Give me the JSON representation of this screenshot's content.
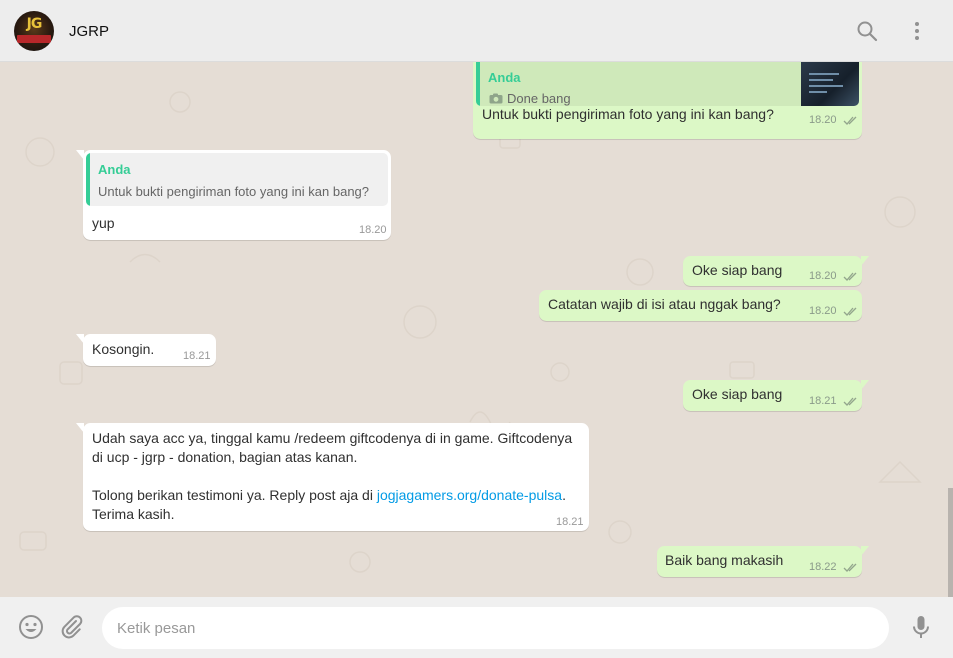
{
  "header": {
    "contact_name": "JGRP",
    "avatar_logo": "JG",
    "search_icon": "search-icon",
    "menu_icon": "more-vertical-icon"
  },
  "messages": [
    {
      "direction": "out",
      "quote": {
        "author": "Anda",
        "text": "Done bang",
        "icon": "camera-icon",
        "has_thumbnail": true
      },
      "text": "Untuk bukti pengiriman foto yang ini kan bang?",
      "time": "18.20",
      "status": "read"
    },
    {
      "direction": "in",
      "quote": {
        "author": "Anda",
        "text": "Untuk bukti pengiriman foto yang ini kan bang?"
      },
      "text": "yup",
      "time": "18.20"
    },
    {
      "direction": "out",
      "text": "Oke siap bang",
      "time": "18.20",
      "status": "read"
    },
    {
      "direction": "out",
      "text": "Catatan wajib di isi atau nggak bang?",
      "time": "18.20",
      "status": "read"
    },
    {
      "direction": "in",
      "text": "Kosongin.",
      "time": "18.21"
    },
    {
      "direction": "out",
      "text": "Oke siap bang",
      "time": "18.21",
      "status": "read"
    },
    {
      "direction": "in",
      "lines": [
        "Udah saya acc ya, tinggal kamu /redeem giftcodenya di in game. Giftcodenya",
        "di ucp - jgrp - donation, bagian atas kanan.",
        "Tolong berikan testimoni ya. Reply post aja di ",
        "jogjagamers.org/donate-pulsa",
        ".",
        "Terima kasih."
      ],
      "time": "18.21"
    },
    {
      "direction": "out",
      "text": "Baik bang makasih",
      "time": "18.22",
      "status": "read"
    }
  ],
  "composer": {
    "placeholder": "Ketik pesan",
    "emoji_icon": "emoji-icon",
    "attach_icon": "paperclip-icon",
    "mic_icon": "microphone-icon"
  },
  "colors": {
    "outgoing_bubble": "#dcf8c6",
    "incoming_bubble": "#ffffff",
    "quote_author": "#35cd96",
    "link": "#039be5",
    "chat_background": "#e5ddd5"
  }
}
